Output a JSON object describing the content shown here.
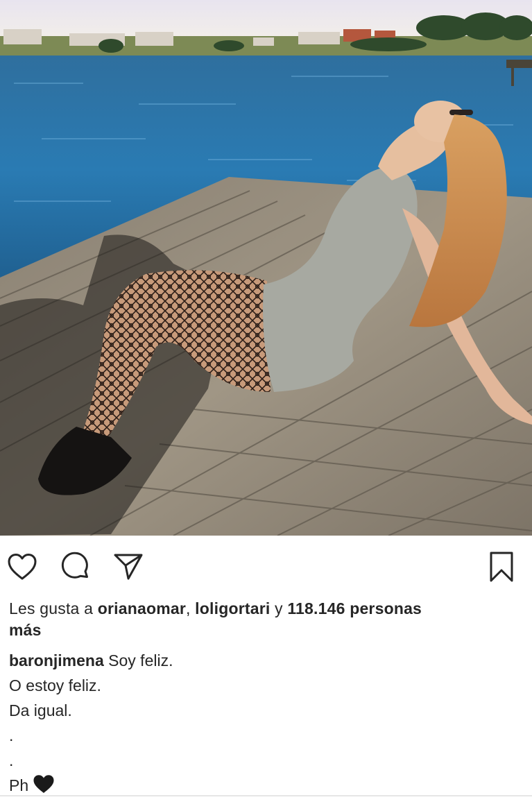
{
  "photo": {
    "alt_subject": "woman-sitting-on-dock"
  },
  "actions": {
    "like_icon": "heart-outline-icon",
    "comment_icon": "comment-bubble-icon",
    "share_icon": "paper-plane-icon",
    "save_icon": "bookmark-icon"
  },
  "likes": {
    "prefix": "Les gusta a ",
    "user1": "orianaomar",
    "sep": ", ",
    "user2": "loligortari",
    "connector": " y ",
    "count": "118.146 personas",
    "suffix": "más"
  },
  "caption": {
    "username": "baronjimena",
    "first": " Soy feliz.",
    "line2": "O estoy feliz.",
    "line3": "Da igual.",
    "line4": ".",
    "line5": ".",
    "line6": "Ph"
  },
  "colors": {
    "text": "#262626",
    "divider": "#e6e6e6"
  }
}
